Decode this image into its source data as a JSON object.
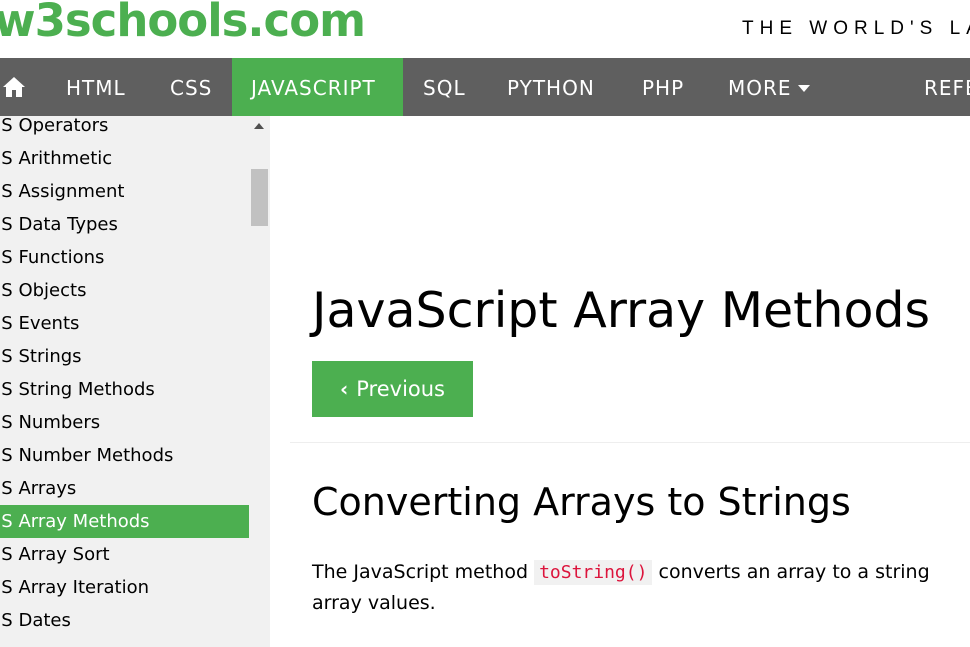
{
  "header": {
    "logo": "w3schools.com",
    "tagline": "THE WORLD'S LA"
  },
  "navbar": {
    "home_icon": "home-icon",
    "items": [
      {
        "label": "HTML",
        "active": false
      },
      {
        "label": "CSS",
        "active": false
      },
      {
        "label": "JAVASCRIPT",
        "active": true
      },
      {
        "label": "SQL",
        "active": false
      },
      {
        "label": "PYTHON",
        "active": false
      },
      {
        "label": "PHP",
        "active": false
      },
      {
        "label": "MORE",
        "active": false
      },
      {
        "label": "REFE",
        "active": false
      }
    ]
  },
  "sidebar": {
    "items": [
      {
        "label": "JS Operators"
      },
      {
        "label": "JS Arithmetic"
      },
      {
        "label": "JS Assignment"
      },
      {
        "label": "JS Data Types"
      },
      {
        "label": "JS Functions"
      },
      {
        "label": "JS Objects"
      },
      {
        "label": "JS Events"
      },
      {
        "label": "JS Strings"
      },
      {
        "label": "JS String Methods"
      },
      {
        "label": "JS Numbers"
      },
      {
        "label": "JS Number Methods"
      },
      {
        "label": "JS Arrays"
      },
      {
        "label": "JS Array Methods",
        "active": true
      },
      {
        "label": "JS Array Sort"
      },
      {
        "label": "JS Array Iteration"
      },
      {
        "label": "JS Dates"
      }
    ]
  },
  "main": {
    "title": "JavaScript Array Methods",
    "prev_button": "Previous",
    "section_title": "Converting Arrays to Strings",
    "para_before": "The JavaScript method ",
    "para_code": "toString()",
    "para_after": " converts an array to a string",
    "para_line2": "array values."
  },
  "colors": {
    "brand_green": "#4CAF50",
    "navbar_bg": "#5f5f5f",
    "sidebar_bg": "#f1f1f1",
    "code_red": "#dc143c"
  }
}
